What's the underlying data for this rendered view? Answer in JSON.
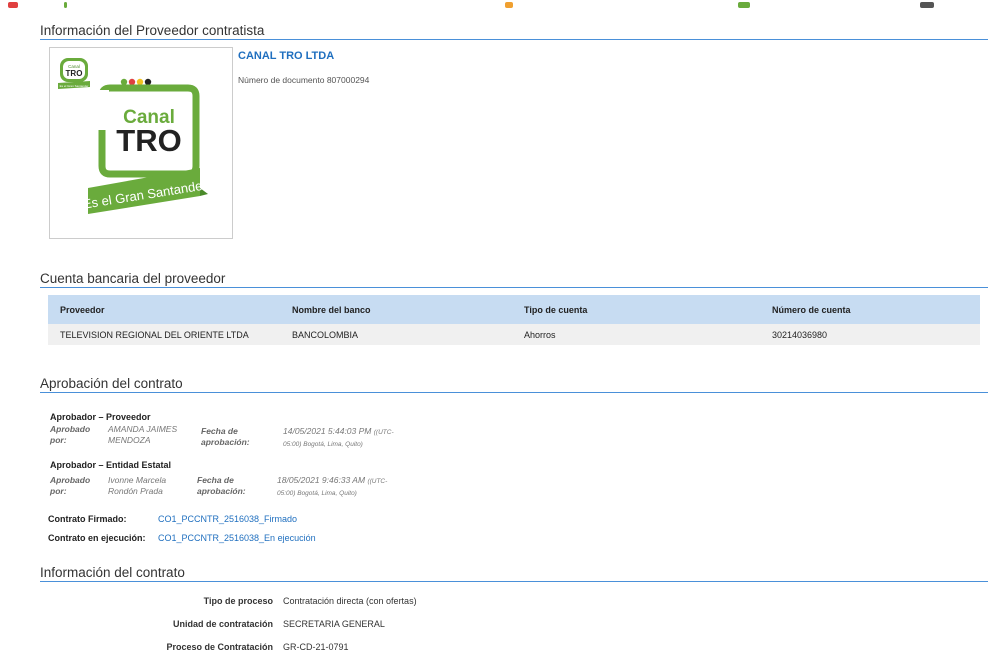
{
  "provider_section": {
    "title": "Información del Proveedor contratista",
    "name": "CANAL TRO LTDA",
    "document_line": "Número de documento 807000294",
    "logo": {
      "small_badge": "TRO",
      "small_badge_top": "Canal",
      "small_ribbon": "Es el Gran Santander",
      "brand_top": "Canal",
      "brand_main": "TRO",
      "ribbon": "Es el Gran Santander",
      "colors": {
        "green": "#6aab3c",
        "dark_green": "#4a8a2a",
        "dark": "#222222"
      }
    }
  },
  "bank_section": {
    "title": "Cuenta bancaria del proveedor",
    "columns": [
      "Proveedor",
      "Nombre del banco",
      "Tipo de cuenta",
      "Número de cuenta"
    ],
    "rows": [
      [
        "TELEVISION REGIONAL DEL ORIENTE LTDA",
        "BANCOLOMBIA",
        "Ahorros",
        "30214036980"
      ]
    ]
  },
  "approval_section": {
    "title": "Aprobación del contrato",
    "approvers": [
      {
        "heading": "Aprobador – Proveedor",
        "approved_by_label_1": "Aprobado",
        "approved_by_label_2": "por:",
        "name_1": "AMANDA JAIMES",
        "name_2": "MENDOZA",
        "date_label_1": "Fecha de",
        "date_label_2": "aprobación:",
        "date_1": "14/05/2021 5:44:03 PM",
        "tz_1": "((UTC-",
        "tz_2": "05:00) Bogotá, Lima, Quito)"
      },
      {
        "heading": "Aprobador – Entidad Estatal",
        "approved_by_label_1": "Aprobado",
        "approved_by_label_2": "por:",
        "name_1": "Ivonne Marcela",
        "name_2": "Rondón Prada",
        "date_label_1": "Fecha de",
        "date_label_2": "aprobación:",
        "date_1": "18/05/2021 9:46:33 AM",
        "tz_1": "((UTC-",
        "tz_2": "05:00) Bogotá, Lima, Quito)"
      }
    ],
    "signed_label": "Contrato Firmado:",
    "signed_link": "CO1_PCCNTR_2516038_Firmado",
    "execution_label": "Contrato en ejecución:",
    "execution_link": "CO1_PCCNTR_2516038_En ejecución"
  },
  "contract_section": {
    "title": "Información del contrato",
    "fields": [
      {
        "label": "Tipo de proceso",
        "value": "Contratación directa (con ofertas)"
      },
      {
        "label": "Unidad de contratación",
        "value": "SECRETARIA GENERAL"
      },
      {
        "label": "Proceso de Contratación",
        "value": "GR-CD-21-0791"
      }
    ]
  }
}
